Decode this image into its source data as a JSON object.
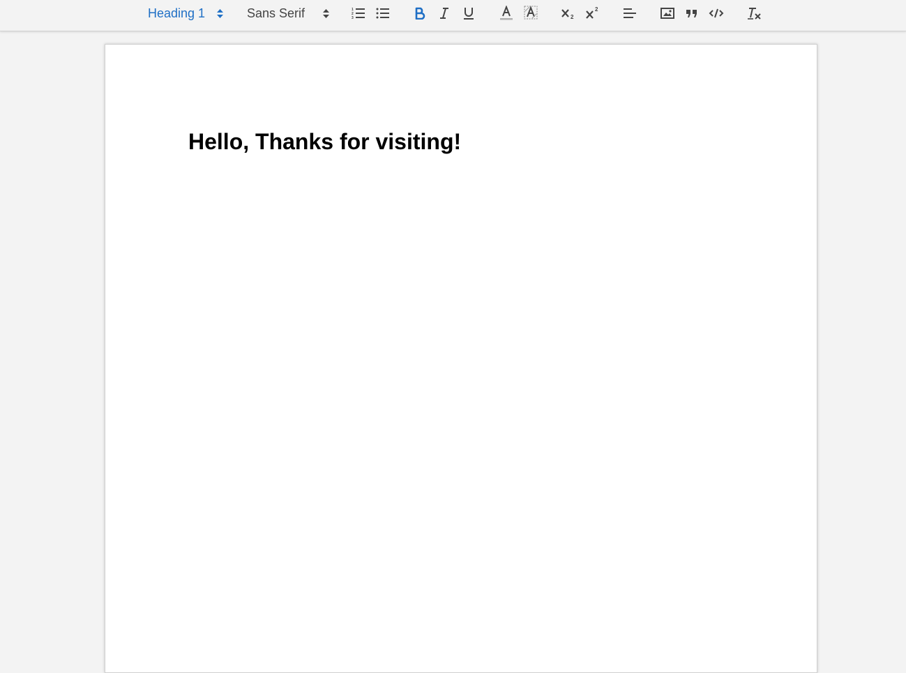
{
  "toolbar": {
    "header_picker": {
      "selected": "Heading 1",
      "icon": "up-down-arrows-icon"
    },
    "font_picker": {
      "selected": "Sans Serif",
      "icon": "up-down-arrows-icon"
    },
    "buttons": [
      {
        "name": "ordered-list",
        "icon": "ordered-list-icon"
      },
      {
        "name": "bullet-list",
        "icon": "bullet-list-icon"
      },
      {
        "name": "bold",
        "icon": "bold-icon",
        "active": true
      },
      {
        "name": "italic",
        "icon": "italic-icon"
      },
      {
        "name": "underline",
        "icon": "underline-icon"
      },
      {
        "name": "text-color",
        "icon": "text-color-icon"
      },
      {
        "name": "background-color",
        "icon": "highlight-color-icon"
      },
      {
        "name": "subscript",
        "icon": "subscript-icon"
      },
      {
        "name": "superscript",
        "icon": "superscript-icon"
      },
      {
        "name": "align",
        "icon": "align-left-icon"
      },
      {
        "name": "image",
        "icon": "image-icon"
      },
      {
        "name": "blockquote",
        "icon": "quote-icon"
      },
      {
        "name": "code-block",
        "icon": "code-icon"
      },
      {
        "name": "clear-formatting",
        "icon": "clear-format-icon"
      }
    ],
    "colors": {
      "active": "#1f6fc5",
      "icon": "#444444"
    }
  },
  "editor": {
    "heading_text": "Hello, Thanks for visiting!"
  }
}
